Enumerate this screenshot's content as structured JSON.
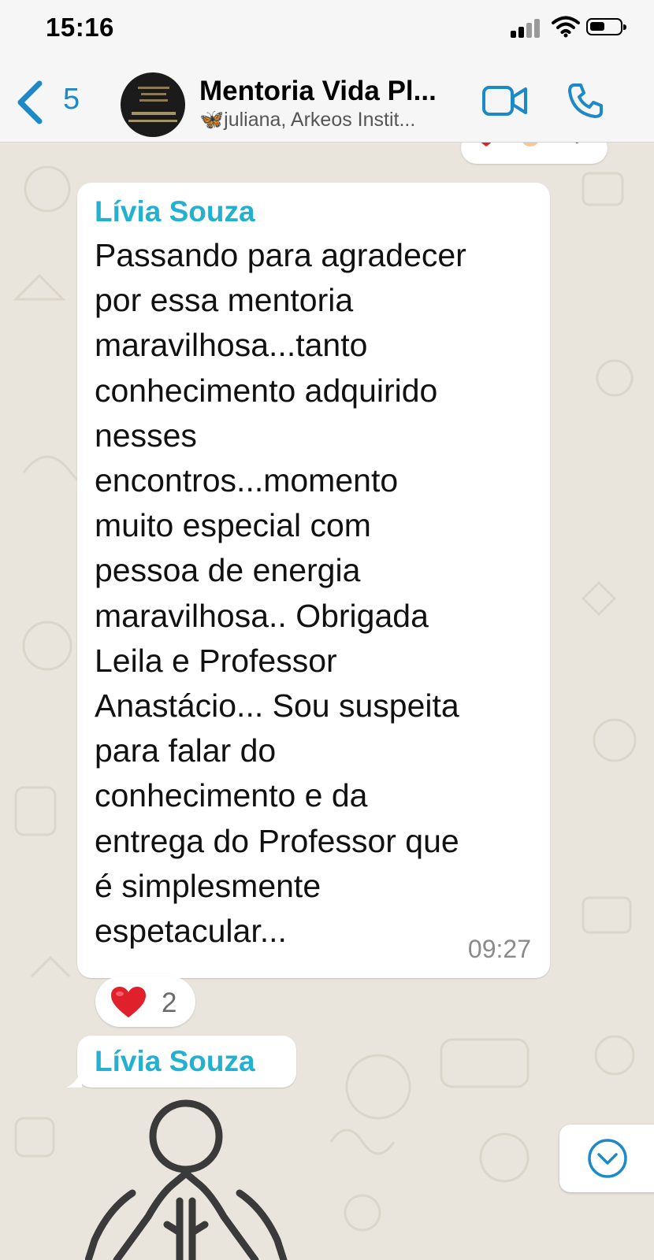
{
  "status_bar": {
    "time": "15:16"
  },
  "header": {
    "back_count": "5",
    "title": "Mentoria Vida Pl...",
    "subtitle_emoji": "🦋",
    "subtitle": "juliana, Arkeos Instit..."
  },
  "messages": [
    {
      "sender": "Lívia Souza",
      "text": "Passando para agradecer\npor essa mentoria\nmaravilhosa...tanto\nconhecimento adquirido\nnesses\nencontros...momento\nmuito especial com\npessoa de energia\nmaravilhosa.. Obrigada\nLeila e Professor\nAnastácio... Sou suspeita\npara falar do\nconhecimento e da\nentrega do Professor que\né simplesmente\nespetacular...",
      "time": "09:27",
      "reaction": {
        "emoji": "heart-icon",
        "count": "2"
      }
    },
    {
      "sender": "Lívia Souza",
      "sticker": "praying-hands-icon"
    }
  ],
  "colors": {
    "accent": "#1d89c7",
    "sender": "#24b0cf",
    "chat_background": "#e9e4dc",
    "bubble": "#ffffff"
  }
}
